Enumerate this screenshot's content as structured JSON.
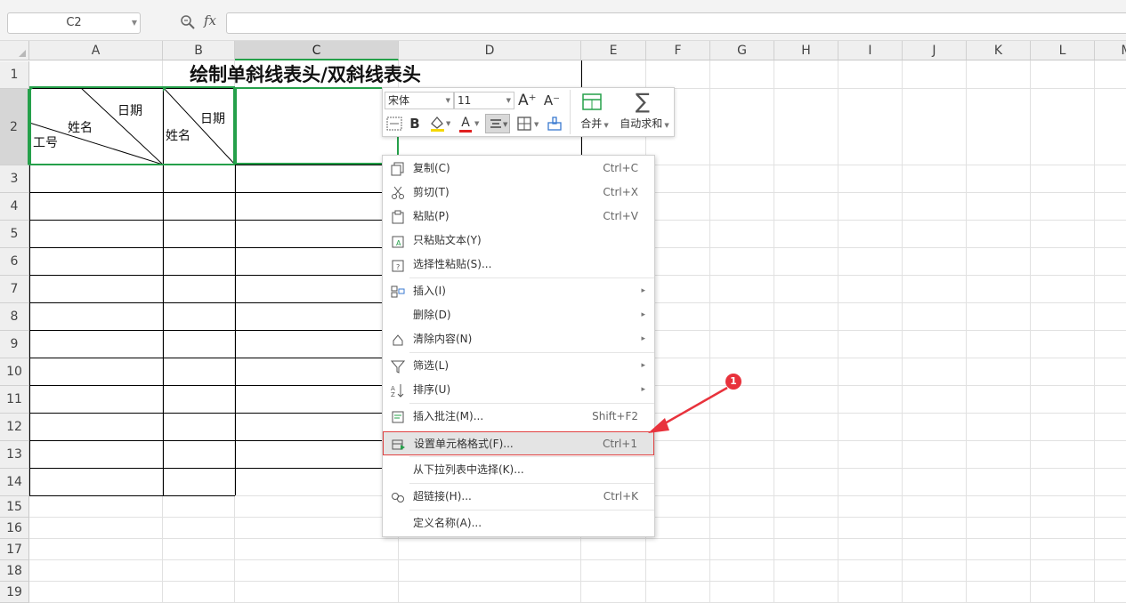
{
  "formula_bar": {
    "cell_ref": "C2",
    "fx_label": "fx",
    "formula_value": ""
  },
  "columns": [
    "A",
    "B",
    "C",
    "D",
    "E",
    "F",
    "G",
    "H",
    "I",
    "J",
    "K",
    "L",
    "M"
  ],
  "rows": [
    "1",
    "2",
    "3",
    "4",
    "5",
    "6",
    "7",
    "8",
    "9",
    "10",
    "11",
    "12",
    "13",
    "14",
    "15",
    "16",
    "17",
    "18",
    "19"
  ],
  "sheet": {
    "title": "绘制单斜线表头/双斜线表头",
    "cellA2": {
      "top_right": "日期",
      "middle": "姓名",
      "bottom_left": "工号"
    },
    "cellB2": {
      "top_right": "日期",
      "bottom_left": "姓名"
    }
  },
  "mini_toolbar": {
    "font_name": "宋体",
    "font_size": "11",
    "increase_font": "A⁺",
    "decrease_font": "A⁻",
    "bold": "B",
    "font_color_letter": "A",
    "merge_label": "合并",
    "autosum_label": "自动求和",
    "font_color": "#e02020",
    "fill_color": "#f5d800",
    "accent": "#25a04a"
  },
  "context_menu": {
    "items": [
      {
        "label": "复制(C)",
        "shortcut": "Ctrl+C",
        "icon": "copy-icon"
      },
      {
        "label": "剪切(T)",
        "shortcut": "Ctrl+X",
        "icon": "cut-icon"
      },
      {
        "label": "粘贴(P)",
        "shortcut": "Ctrl+V",
        "icon": "paste-icon"
      },
      {
        "label": "只粘贴文本(Y)",
        "shortcut": "",
        "icon": "paste-text-icon"
      },
      {
        "label": "选择性粘贴(S)...",
        "shortcut": "",
        "icon": "paste-special-icon"
      },
      {
        "label": "插入(I)",
        "shortcut": "",
        "icon": "insert-icon"
      },
      {
        "label": "删除(D)",
        "shortcut": "",
        "icon": ""
      },
      {
        "label": "清除内容(N)",
        "shortcut": "",
        "icon": "clear-icon"
      },
      {
        "label": "筛选(L)",
        "shortcut": "",
        "icon": "filter-icon"
      },
      {
        "label": "排序(U)",
        "shortcut": "",
        "icon": "sort-icon"
      },
      {
        "label": "插入批注(M)...",
        "shortcut": "Shift+F2",
        "icon": "comment-icon"
      },
      {
        "label": "设置单元格格式(F)...",
        "shortcut": "Ctrl+1",
        "icon": "format-cells-icon"
      },
      {
        "label": "从下拉列表中选择(K)...",
        "shortcut": "",
        "icon": ""
      },
      {
        "label": "超链接(H)...",
        "shortcut": "Ctrl+K",
        "icon": "link-icon"
      },
      {
        "label": "定义名称(A)...",
        "shortcut": "",
        "icon": ""
      }
    ]
  },
  "annotation": {
    "badge_number": "1",
    "color": "#e8323c"
  }
}
